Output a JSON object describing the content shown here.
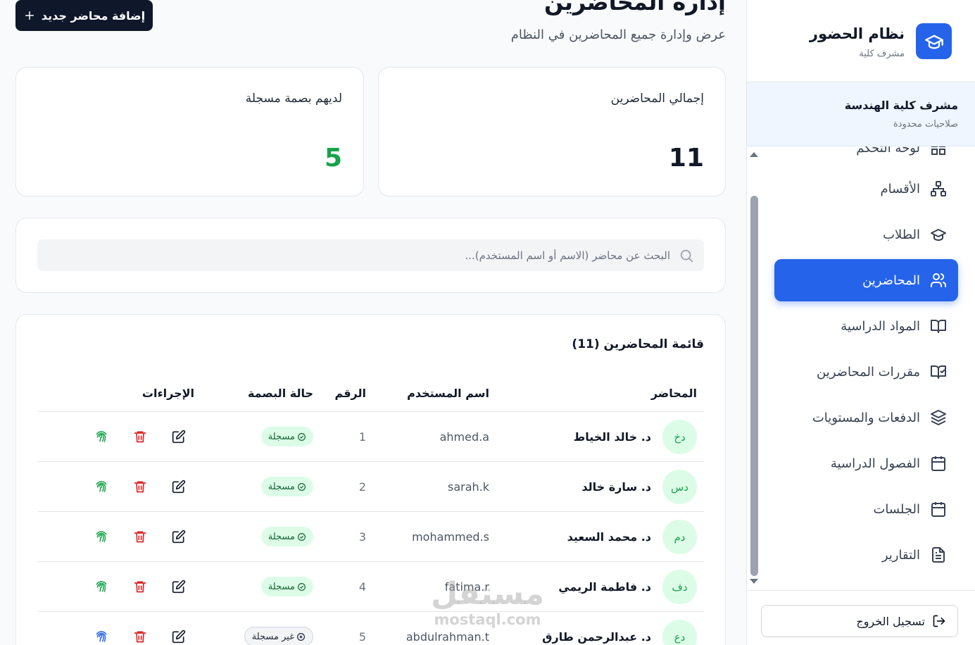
{
  "brand": {
    "title": "نظام الحضور",
    "subtitle": "مشرف كلية"
  },
  "role": {
    "title": "مشرف كلية الهندسة",
    "subtitle": "صلاحيات محدودة"
  },
  "sidebar": {
    "items": [
      {
        "label": "لوحة التحكم",
        "icon": "dashboard-icon"
      },
      {
        "label": "الأقسام",
        "icon": "sitemap-icon"
      },
      {
        "label": "الطلاب",
        "icon": "graduation-cap-icon"
      },
      {
        "label": "المحاضرين",
        "icon": "users-icon"
      },
      {
        "label": "المواد الدراسية",
        "icon": "book-open-icon"
      },
      {
        "label": "مقررات المحاضرين",
        "icon": "book-check-icon"
      },
      {
        "label": "الدفعات والمستويات",
        "icon": "layers-icon"
      },
      {
        "label": "الفصول الدراسية",
        "icon": "calendar-grid-icon"
      },
      {
        "label": "الجلسات",
        "icon": "calendar-icon"
      },
      {
        "label": "التقارير",
        "icon": "file-text-icon"
      }
    ],
    "active_item": "المحاضرين",
    "logout_label": "تسجيل الخروج"
  },
  "header": {
    "title": "إدارة المحاضرين",
    "subtitle": "عرض وإدارة جميع المحاضرين في النظام",
    "add_button": "إضافة محاضر جديد"
  },
  "stats": {
    "total_label": "إجمالي المحاضرين",
    "total_value": "11",
    "fingerprint_label": "لديهم بصمة مسجلة",
    "fingerprint_value": "5"
  },
  "search": {
    "placeholder": "البحث عن محاضر (الاسم أو اسم المستخدم)..."
  },
  "table": {
    "title": "قائمة المحاضرين (11)",
    "headers": {
      "lecturer": "المحاضر",
      "username": "اسم المستخدم",
      "number": "الرقم",
      "fingerprint": "حالة البصمة",
      "actions": "الإجراءات"
    },
    "rows": [
      {
        "initials": "دخ",
        "name": "د. خالد الخياط",
        "username": "ahmed.a",
        "number": "1",
        "status": "مسجلة",
        "registered": true
      },
      {
        "initials": "دس",
        "name": "د. سارة خالد",
        "username": "sarah.k",
        "number": "2",
        "status": "مسجلة",
        "registered": true
      },
      {
        "initials": "دم",
        "name": "د. محمد السعيد",
        "username": "mohammed.s",
        "number": "3",
        "status": "مسجلة",
        "registered": true
      },
      {
        "initials": "دف",
        "name": "د. فاطمة الريمي",
        "username": "fatima.r",
        "number": "4",
        "status": "مسجلة",
        "registered": true
      },
      {
        "initials": "دع",
        "name": "د. عبدالرحمن طارق",
        "username": "abdulrahman.t",
        "number": "5",
        "status": "غير مسجلة",
        "registered": false
      }
    ]
  },
  "watermark": {
    "main": "مستقل",
    "sub": "mostaql.com"
  },
  "colors": {
    "primary": "#2563eb",
    "success": "#16a34a",
    "danger": "#dc2626",
    "dark": "#0f172a"
  }
}
